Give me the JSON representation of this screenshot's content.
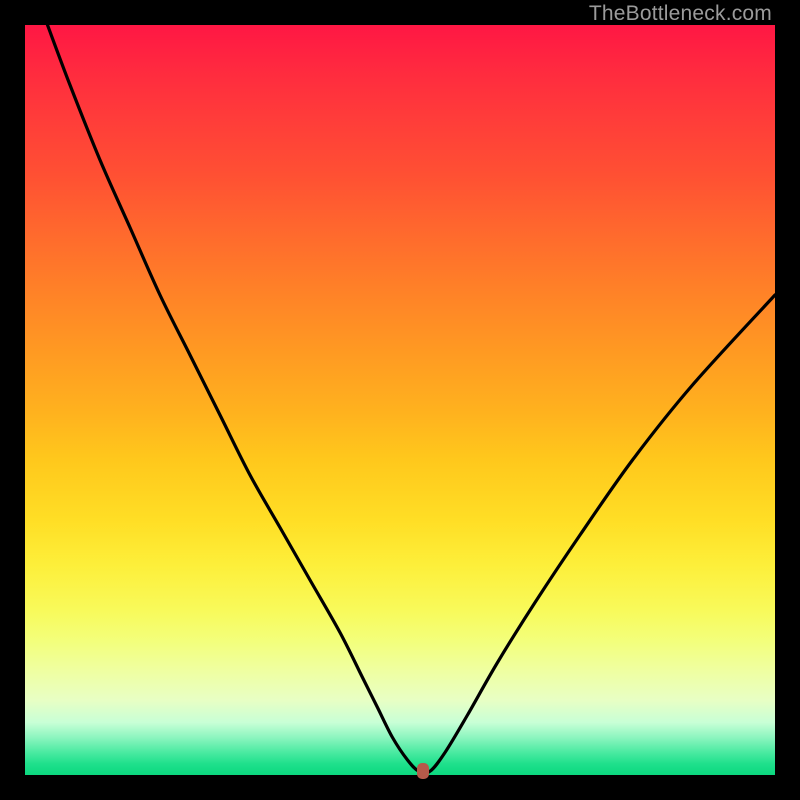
{
  "watermark": "TheBottleneck.com",
  "chart_data": {
    "type": "line",
    "title": "",
    "xlabel": "",
    "ylabel": "",
    "xlim": [
      0,
      100
    ],
    "ylim": [
      0,
      100
    ],
    "grid": false,
    "series": [
      {
        "name": "curve",
        "x": [
          3,
          6,
          10,
          14,
          18,
          22,
          26,
          30,
          34,
          38,
          42,
          45,
          47,
          49,
          51,
          52.5,
          54,
          56,
          59,
          63,
          68,
          74,
          81,
          89,
          100
        ],
        "y": [
          100,
          92,
          82,
          73,
          64,
          56,
          48,
          40,
          33,
          26,
          19,
          13,
          9,
          5,
          2,
          0.5,
          0.5,
          3,
          8,
          15,
          23,
          32,
          42,
          52,
          64
        ]
      }
    ],
    "marker": {
      "x": 53,
      "y": 0.5,
      "color": "#b55a4a"
    },
    "background_gradient": {
      "top": "#ff1744",
      "mid": "#ffde25",
      "bottom": "#0bd87f"
    }
  }
}
